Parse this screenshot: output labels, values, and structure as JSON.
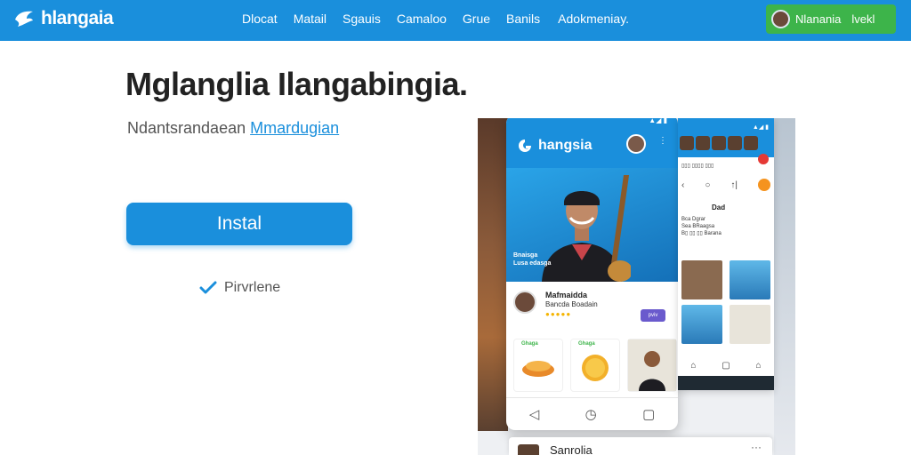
{
  "header": {
    "logo_text": "hlangaia",
    "logo_icon": "bird-logo-icon",
    "nav": [
      "Dlocat",
      "Matail",
      "Sgauis",
      "Camaloo",
      "Grue",
      "Banils",
      "Adokmeniay."
    ],
    "cta": {
      "avatar": "user-avatar",
      "name": "Nlanania",
      "action": "lvekl"
    }
  },
  "hero": {
    "headline": "Mglanglia Ilangabingia.",
    "subline_prefix": "Ndantsrandaean",
    "subline_link": "Mmardugian",
    "install_label": "Instal",
    "check_icon": "checkmark-icon",
    "check_label": "Pirvrlene"
  },
  "promo": {
    "main_phone": {
      "status": "▲◢ ▮",
      "logo_text": "hangsia",
      "caption_line1": "Bnaisga",
      "caption_line2": "Lusa edasga",
      "profile_name": "Mafmaidda",
      "profile_sub": "Bancda Boadain",
      "rating": 5,
      "rating_glyphs": "●●●●●",
      "profile_btn": "pviv",
      "tile_labels": [
        "Ghaga",
        "Ghaga",
        ""
      ],
      "nav_icons": [
        "back-icon",
        "home-icon",
        "recent-apps-icon"
      ],
      "nav_glyphs": [
        "◁",
        "◷",
        "▢"
      ]
    },
    "second_phone": {
      "status": "▲◢ ▮",
      "header_sub": "▯▯▯ ▯▯▯▯ ▯▯▯",
      "icons": [
        "‹",
        "○",
        "↑|"
      ],
      "title": "Dad",
      "lines": [
        "Bca Dgrar",
        "Sea BRaagsa",
        "B▯ ▯▯ ▯▯ Barana"
      ],
      "nav_glyphs": [
        "⌂",
        "▢",
        "⌂"
      ]
    },
    "bottom_card": {
      "label": "Sanrolia",
      "menu": "···"
    }
  }
}
